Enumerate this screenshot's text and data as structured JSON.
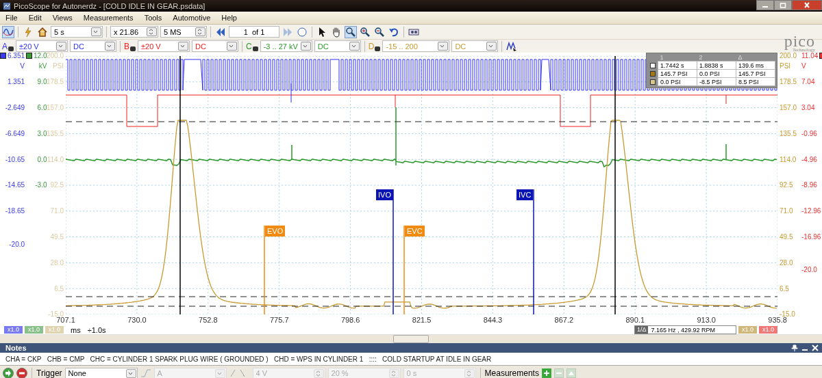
{
  "window": {
    "title": "PicoScope for Autonerdz - [COLD IDLE IN GEAR.psdata]"
  },
  "menu": [
    "File",
    "Edit",
    "Views",
    "Measurements",
    "Tools",
    "Automotive",
    "Help"
  ],
  "toolbar": {
    "timebase": "5 s",
    "zoom": "x 21.86",
    "samples": "5 MS",
    "page": "1  of 1"
  },
  "logo": {
    "text": "pico",
    "subtitle": "Technology"
  },
  "channels": [
    {
      "letter": "A",
      "range": "±20 V",
      "coupling": "DC",
      "color": "#3030f0"
    },
    {
      "letter": "B",
      "range": "±20 V",
      "coupling": "DC",
      "color": "#f02020"
    },
    {
      "letter": "C",
      "range": "-3 .. 27 kV",
      "coupling": "DC",
      "color": "#2a9a2a"
    },
    {
      "letter": "D",
      "range": "-15 .. 200",
      "coupling": "DC",
      "color": "#c89a30"
    }
  ],
  "plot": {
    "left_axes": [
      {
        "unit": "V",
        "color": "#3a3af0",
        "swatch": true,
        "ticks": [
          "6.351",
          "1.351",
          "-2.649",
          "-6.649",
          "-10.65",
          "-14.65",
          "-18.65"
        ],
        "floor": "-20.0"
      },
      {
        "unit": "kV",
        "color": "#3a9a3a",
        "swatch": true,
        "ticks": [
          "12.0",
          "9.0",
          "6.0",
          "3.0",
          "0.0",
          "-3.0"
        ]
      },
      {
        "unit": "PSI",
        "color": "#dccba0",
        "ticks": [
          "200.0",
          "178.5",
          "157.0",
          "135.5",
          "114.0",
          "92.5",
          "71.0",
          "49.5",
          "28.0",
          "6.5",
          "-15.0"
        ]
      }
    ],
    "right_axes": [
      {
        "unit": "PSI",
        "color": "#c89a30",
        "ticks": [
          "200.0",
          "178.5",
          "157.0",
          "135.5",
          "114.0",
          "92.5",
          "71.0",
          "49.5",
          "28.0",
          "6.5",
          "-15.0"
        ]
      },
      {
        "unit": "V",
        "color": "#f03030",
        "swatch": true,
        "ticks": [
          "11.04",
          "7.04",
          "3.04",
          "-0.96",
          "-4.96",
          "-8.96",
          "-12.96",
          "-16.96"
        ],
        "floor": "-20.0"
      }
    ],
    "x_ticks": [
      "707.1",
      "730.0",
      "752.8",
      "775.7",
      "798.6",
      "821.5",
      "844.3",
      "867.2",
      "890.1",
      "913.0",
      "935.8"
    ],
    "markers": [
      {
        "label": "EVO",
        "color": "#f08a10"
      },
      {
        "label": "IVO",
        "color": "#0a14b4"
      },
      {
        "label": "EVC",
        "color": "#f08a10"
      },
      {
        "label": "IVC",
        "color": "#0a14b4"
      }
    ],
    "measure_table": {
      "columns": [
        "1",
        "2",
        "Δ"
      ],
      "rows": [
        [
          "1.7442 s",
          "1.8838 s",
          "139.6 ms"
        ],
        [
          "145.7 PSI",
          "0.0 PSI",
          "145.7 PSI"
        ],
        [
          "0.0 PSI",
          "-8.5 PSI",
          "8.5 PSI"
        ]
      ]
    },
    "x_unit": "ms",
    "x_scale": "÷1.0s",
    "scale_badges_left": [
      {
        "label": "x1.0",
        "color": "#7a7af0"
      },
      {
        "label": "x1.0",
        "color": "#8ac08a"
      },
      {
        "label": "x1.0",
        "color": "#e0d4b0"
      }
    ],
    "scale_badges_right": [
      {
        "label": "x1.0",
        "color": "#cfb87a"
      },
      {
        "label": "x1.0",
        "color": "#f07878"
      }
    ],
    "readout": {
      "label": "1/Δ",
      "value": "7.165 Hz , 429.92 RPM"
    }
  },
  "notes": {
    "title": "Notes",
    "text": "CHA = CKP   CHB = CMP   CHC = CYLINDER 1 SPARK PLUG WIRE ( GROUNDED )   CHD = WPS IN CYLINDER 1   ::::   COLD STARTUP AT IDLE IN GEAR"
  },
  "trigger_bar": {
    "label": "Trigger",
    "mode": "None",
    "fields": [
      {
        "kind": "dropdown",
        "value": "A",
        "disabled": true
      },
      {
        "kind": "spinner",
        "value": "4 V",
        "disabled": true
      },
      {
        "kind": "spinner",
        "value": "20 %",
        "disabled": true
      },
      {
        "kind": "spinner",
        "value": "0 s",
        "disabled": true
      }
    ],
    "measurements": "Measurements"
  }
}
